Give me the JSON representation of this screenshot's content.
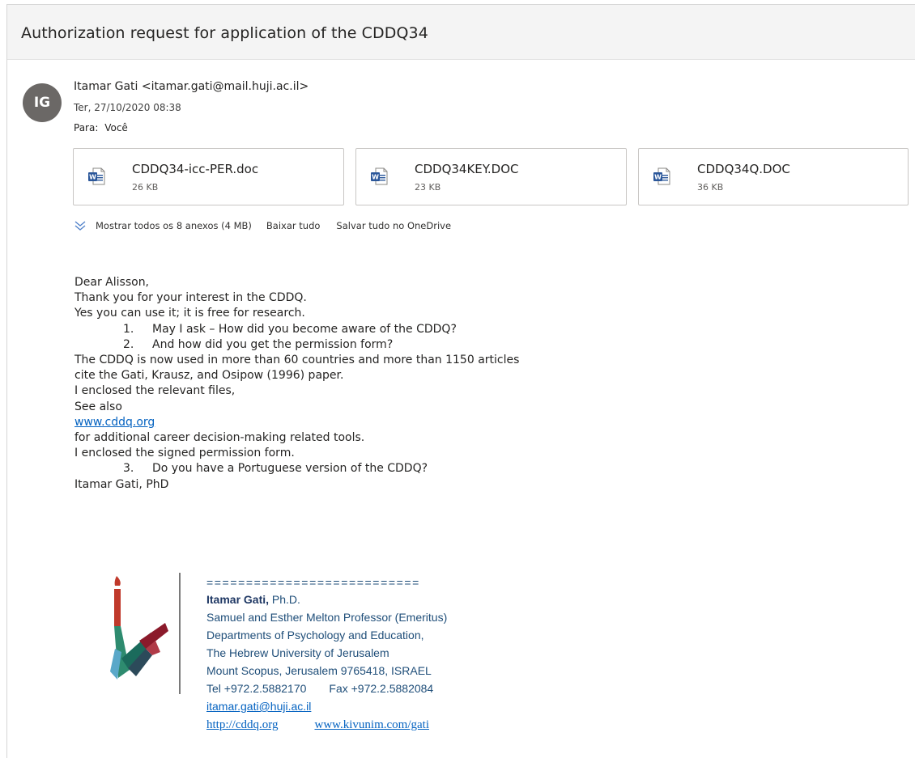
{
  "email": {
    "subject": "Authorization request for application of the CDDQ34",
    "sender": {
      "initials": "IG",
      "display": "Itamar Gati <itamar.gati@mail.huji.ac.il>"
    },
    "date": "Ter, 27/10/2020 08:38",
    "to": {
      "label": "Para:",
      "value": "Você"
    }
  },
  "attachments": [
    {
      "name": "CDDQ34-icc-PER.doc",
      "size": "26 KB",
      "icon": "word-doc-icon"
    },
    {
      "name": "CDDQ34KEY.DOC",
      "size": "23 KB",
      "icon": "word-doc-icon"
    },
    {
      "name": "CDDQ34Q.DOC",
      "size": "36 KB",
      "icon": "word-doc-icon"
    }
  ],
  "attachment_actions": {
    "show_all": "Mostrar todos os 8 anexos (4 MB)",
    "download_all": "Baixar tudo",
    "save_onedrive": "Salvar tudo no OneDrive"
  },
  "body": {
    "greeting": "Dear Alisson,",
    "l1": "Thank you for your interest in the CDDQ.",
    "l2": "Yes you can use it; it is free for research.",
    "q1_num": "1.",
    "q1": "May I ask – How did you become aware of the CDDQ?",
    "q2_num": "2.",
    "q2": "And how did you get the permission form?",
    "l3": "The CDDQ is now used in more than 60 countries and more than 1150 articles",
    "l4": "cite the Gati, Krausz, and Osipow (1996) paper.",
    "l5": "I enclosed the relevant files,",
    "l6": "See also",
    "link": "www.cddq.org",
    "l7": "for additional career decision-making related tools.",
    "l8": "I enclosed the signed permission form.",
    "q3_num": "3.",
    "q3": "Do you have a Portuguese version of the CDDQ?",
    "closing": "Itamar Gati, PhD"
  },
  "signature": {
    "separator": "===========================",
    "name": "Itamar Gati,",
    "degree": " Ph.D.",
    "title": "Samuel and Esther Melton Professor  (Emeritus)",
    "department": "Departments of Psychology and Education,",
    "university": "The Hebrew University of Jerusalem",
    "address": "Mount Scopus, Jerusalem 9765418,  ISRAEL",
    "tel": "Tel +972.2.5882170",
    "fax": "Fax +972.2.5882084",
    "email": "itamar.gati@huji.ac.il",
    "link1": "http://cddq.org",
    "link2": "www.kivunim.com/gati"
  },
  "colors": {
    "word_blue": "#2b579a",
    "link": "#0563c1",
    "signature": "#1f4e79",
    "avatar": "#6b6866"
  }
}
